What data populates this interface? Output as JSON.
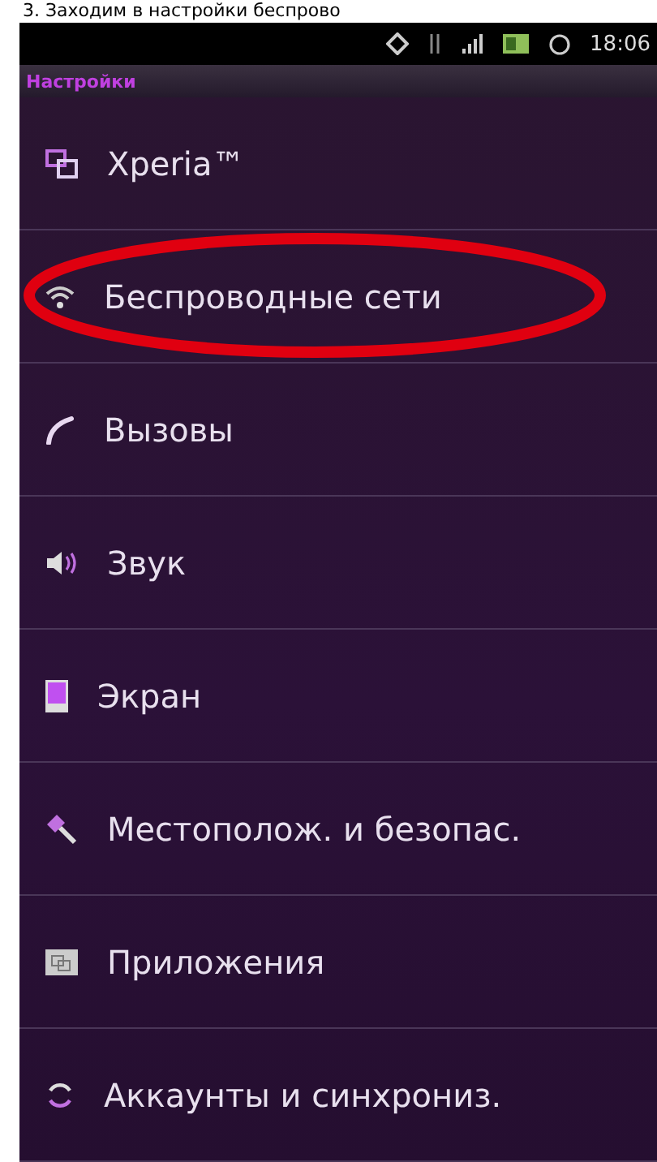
{
  "caption": "3. Заходим в настройки беспрово",
  "status_bar": {
    "time": "18:06"
  },
  "header": {
    "title": "Настройки"
  },
  "items": [
    {
      "label": "Xperia™",
      "circled": false
    },
    {
      "label": "Беспроводные сети",
      "circled": true
    },
    {
      "label": "Вызовы",
      "circled": false
    },
    {
      "label": "Звук",
      "circled": false
    },
    {
      "label": "Экран",
      "circled": false
    },
    {
      "label": "Местополож. и безопас.",
      "circled": false
    },
    {
      "label": "Приложения",
      "circled": false
    },
    {
      "label": "Аккаунты и синхрониз.",
      "circled": false
    }
  ]
}
